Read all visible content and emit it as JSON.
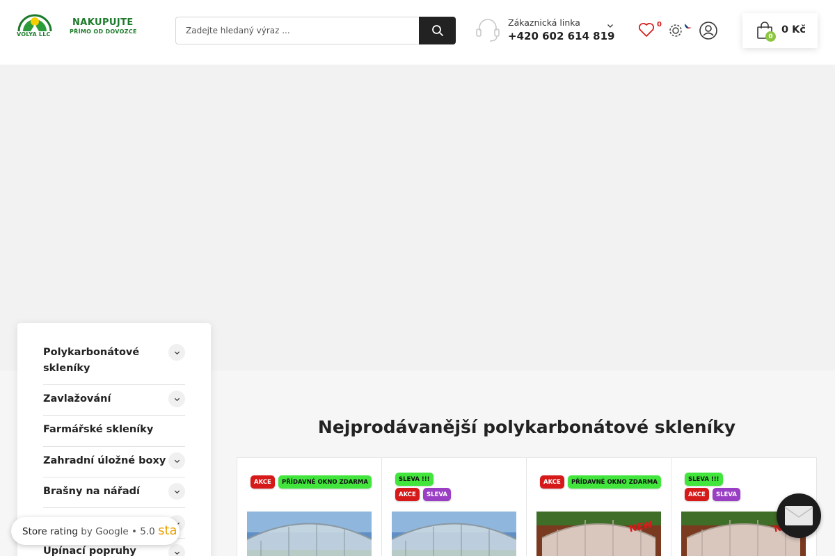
{
  "header": {
    "logo": {
      "company": "VOLYA LLC",
      "tagline_line1": "NAKUPUJTE",
      "tagline_line2": "PŘÍMO OD DOVOZCE"
    },
    "search": {
      "placeholder": "Zadejte hledaný výraz ..."
    },
    "hotline": {
      "label": "Zákaznická linka",
      "phone": "+420 602 614 819"
    },
    "wishlist_count": "0",
    "cart": {
      "count": "0",
      "total": "0 Kč"
    }
  },
  "category_menu": {
    "items": [
      {
        "label": "Polykarbonátové skleníky",
        "has_children": true
      },
      {
        "label": "Zavlažování",
        "has_children": true
      },
      {
        "label": "Farmářské skleníky",
        "has_children": false
      },
      {
        "label": "Zahradní úložné boxy",
        "has_children": true
      },
      {
        "label": "Brašny na nářadí",
        "has_children": true
      },
      {
        "label": "",
        "has_children": true
      },
      {
        "label": "Upínací popruhy",
        "has_children": true
      }
    ]
  },
  "bestsellers": {
    "title": "Nejprodávanější polykarbonátové skleníky",
    "products": [
      {
        "badges_row1": [
          "AKCE",
          "PŘÍDAVNÉ OKNO ZDARMA"
        ],
        "badges_row2": [],
        "image": "greenhouse-photo"
      },
      {
        "badges_row1": [
          "SLEVA !!!"
        ],
        "badges_row2": [
          "AKCE",
          "SLEVA"
        ],
        "image": "greenhouse-photo"
      },
      {
        "badges_row1": [
          "AKCE",
          "PŘÍDAVNÉ OKNO ZDARMA"
        ],
        "badges_row2": [],
        "image": "greenhouse-new-photo"
      },
      {
        "badges_row1": [
          "SLEVA !!!"
        ],
        "badges_row2": [
          "AKCE",
          "SLEVA"
        ],
        "image": "greenhouse-new-photo"
      }
    ]
  },
  "store_rating": {
    "label": "Store rating",
    "by": "by Google",
    "separator": "•",
    "score": "5.0",
    "stars_text": "sta"
  },
  "colors": {
    "brand_green": "#1d7a2b",
    "akce_red": "#d61a1a",
    "promo_green": "#41e53c",
    "sleva_purple": "#9a3ec4",
    "cart_badge": "#8cc63f"
  },
  "icons": [
    "logo-mark",
    "search-icon",
    "headset-icon",
    "chevron-down-icon",
    "heart-icon",
    "gear-icon",
    "czech-flag-icon",
    "user-icon",
    "shopping-bag-icon",
    "chat-icon"
  ]
}
